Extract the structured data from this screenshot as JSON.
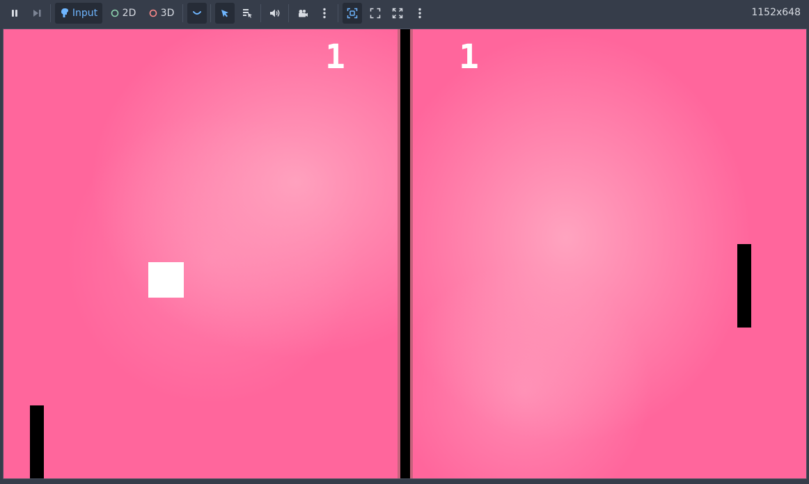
{
  "toolbar": {
    "input_label": "Input",
    "mode_2d_label": "2D",
    "mode_3d_label": "3D",
    "resolution": "1152x648"
  },
  "colors": {
    "background_pink": "#ff669c",
    "highlight_pink": "#ffaac3",
    "divider": "#000000",
    "paddle": "#000000",
    "ball": "#ffffff",
    "score": "#ffffff",
    "accent": "#6fb6ff"
  },
  "game": {
    "left_score": "1",
    "right_score": "1"
  },
  "icons": [
    "pause-icon",
    "step-frame-icon",
    "input-icon",
    "2d-circle-icon",
    "3d-circle-icon",
    "suspend-icon",
    "select-arrow-icon",
    "list-select-icon",
    "audio-icon",
    "camera-override-icon",
    "more-options-icon",
    "embedded-window-icon",
    "keep-aspect-icon",
    "stretch-icon"
  ]
}
